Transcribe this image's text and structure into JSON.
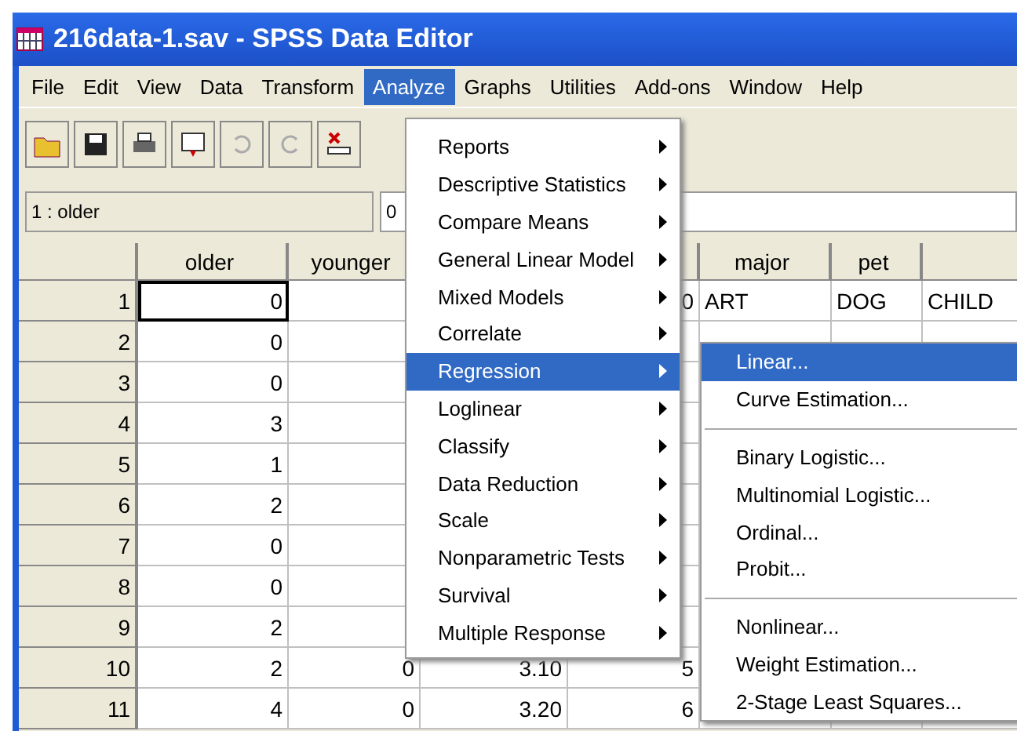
{
  "window": {
    "title": "216data-1.sav - SPSS Data Editor"
  },
  "menu_bar": [
    {
      "label": "File",
      "selected": false
    },
    {
      "label": "Edit",
      "selected": false
    },
    {
      "label": "View",
      "selected": false
    },
    {
      "label": "Data",
      "selected": false
    },
    {
      "label": "Transform",
      "selected": false
    },
    {
      "label": "Analyze",
      "selected": true
    },
    {
      "label": "Graphs",
      "selected": false
    },
    {
      "label": "Utilities",
      "selected": false
    },
    {
      "label": "Add-ons",
      "selected": false
    },
    {
      "label": "Window",
      "selected": false
    },
    {
      "label": "Help",
      "selected": false
    }
  ],
  "cell_editor": {
    "cell": "1 : older",
    "value": "0"
  },
  "table": {
    "columns": [
      {
        "label": "older"
      },
      {
        "label": "younger"
      },
      null,
      null,
      {
        "label": "major"
      },
      {
        "label": "pet"
      },
      null
    ],
    "rows": [
      {
        "header": "1",
        "selected": true,
        "cells": [
          "0",
          null,
          null,
          "0",
          "ART",
          "DOG",
          "CHILD"
        ]
      },
      {
        "header": "2",
        "selected": false,
        "cells": [
          "0",
          null,
          null,
          null,
          null,
          null,
          null
        ]
      },
      {
        "header": "3",
        "selected": false,
        "cells": [
          "0",
          null,
          null,
          null,
          null,
          null,
          null
        ]
      },
      {
        "header": "4",
        "selected": false,
        "cells": [
          "3",
          null,
          null,
          null,
          null,
          null,
          null
        ]
      },
      {
        "header": "5",
        "selected": false,
        "cells": [
          "1",
          null,
          null,
          null,
          null,
          null,
          null
        ]
      },
      {
        "header": "6",
        "selected": false,
        "cells": [
          "2",
          null,
          null,
          null,
          null,
          null,
          null
        ]
      },
      {
        "header": "7",
        "selected": false,
        "cells": [
          "0",
          null,
          null,
          null,
          null,
          null,
          null
        ]
      },
      {
        "header": "8",
        "selected": false,
        "cells": [
          "0",
          null,
          null,
          null,
          null,
          null,
          null
        ]
      },
      {
        "header": "9",
        "selected": false,
        "cells": [
          "2",
          null,
          null,
          null,
          null,
          null,
          null
        ]
      },
      {
        "header": "10",
        "selected": false,
        "cells": [
          "2",
          "0",
          "3.10",
          "5",
          null,
          null,
          null
        ]
      },
      {
        "header": "11",
        "selected": false,
        "cells": [
          "4",
          "0",
          "3.20",
          "6",
          null,
          null,
          null
        ]
      }
    ]
  },
  "analyze_menu": [
    {
      "label": "Reports",
      "selected": false
    },
    {
      "label": "Descriptive Statistics",
      "selected": false
    },
    {
      "label": "Compare Means",
      "selected": false
    },
    {
      "label": "General Linear Model",
      "selected": false
    },
    {
      "label": "Mixed Models",
      "selected": false
    },
    {
      "label": "Correlate",
      "selected": false
    },
    {
      "label": "Regression",
      "selected": true
    },
    {
      "label": "Loglinear",
      "selected": false
    },
    {
      "label": "Classify",
      "selected": false
    },
    {
      "label": "Data Reduction",
      "selected": false
    },
    {
      "label": "Scale",
      "selected": false
    },
    {
      "label": "Nonparametric Tests",
      "selected": false
    },
    {
      "label": "Survival",
      "selected": false
    },
    {
      "label": "Multiple Response",
      "selected": false
    }
  ],
  "regression_menu": [
    {
      "kind": "item",
      "label": "Linear...",
      "selected": true
    },
    {
      "kind": "item",
      "label": "Curve Estimation...",
      "selected": false
    },
    {
      "kind": "separator"
    },
    {
      "kind": "item",
      "label": "Binary Logistic...",
      "selected": false
    },
    {
      "kind": "item",
      "label": "Multinomial Logistic...",
      "selected": false
    },
    {
      "kind": "item",
      "label": "Ordinal...",
      "selected": false
    },
    {
      "kind": "item",
      "label": "Probit...",
      "selected": false
    },
    {
      "kind": "separator"
    },
    {
      "kind": "item",
      "label": "Nonlinear...",
      "selected": false
    },
    {
      "kind": "item",
      "label": "Weight Estimation...",
      "selected": false
    },
    {
      "kind": "item",
      "label": "2-Stage Least Squares...",
      "selected": false
    }
  ]
}
